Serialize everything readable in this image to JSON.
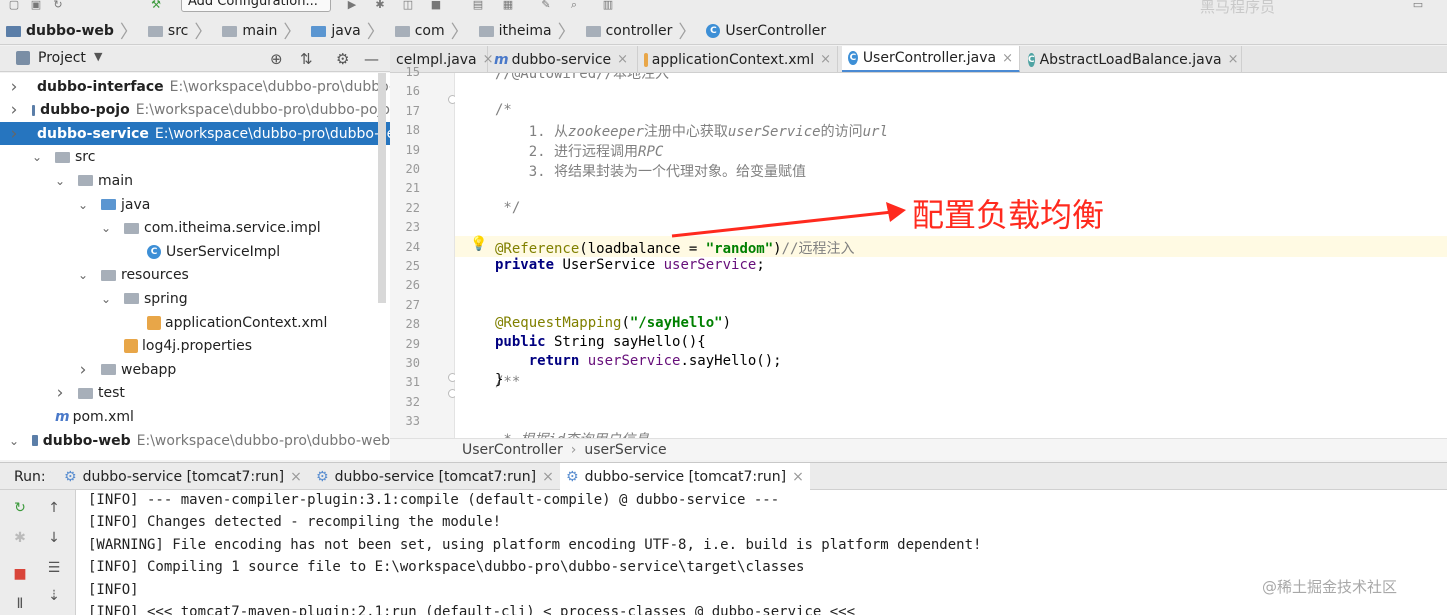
{
  "toolbar": {
    "add_configuration": "Add Configuration..."
  },
  "breadcrumbs": [
    {
      "label": "dubbo-web",
      "icon": "module-folder-icon"
    },
    {
      "label": "src",
      "icon": "folder-icon"
    },
    {
      "label": "main",
      "icon": "folder-icon"
    },
    {
      "label": "java",
      "icon": "source-folder-icon"
    },
    {
      "label": "com",
      "icon": "package-icon"
    },
    {
      "label": "itheima",
      "icon": "package-icon"
    },
    {
      "label": "controller",
      "icon": "package-icon"
    },
    {
      "label": "UserController",
      "icon": "class-icon"
    }
  ],
  "project_panel": {
    "title": "Project",
    "tree": [
      {
        "label": "dubbo-interface",
        "path": "E:\\workspace\\dubbo-pro\\dubbo-",
        "bold": true,
        "arrow": ">",
        "indent": 0,
        "icon": "module"
      },
      {
        "label": "dubbo-pojo",
        "path": "E:\\workspace\\dubbo-pro\\dubbo-pojo",
        "bold": true,
        "arrow": ">",
        "indent": 0,
        "icon": "module"
      },
      {
        "label": "dubbo-service",
        "path": "E:\\workspace\\dubbo-pro\\dubbo-service",
        "bold": true,
        "arrow": ">",
        "indent": 0,
        "icon": "module",
        "selected": true
      },
      {
        "label": "src",
        "path": "",
        "arrow": "v",
        "indent": 1,
        "icon": "folder"
      },
      {
        "label": "main",
        "path": "",
        "arrow": "v",
        "indent": 2,
        "icon": "folder"
      },
      {
        "label": "java",
        "path": "",
        "arrow": "v",
        "indent": 3,
        "icon": "source"
      },
      {
        "label": "com.itheima.service.impl",
        "path": "",
        "arrow": "v",
        "indent": 4,
        "icon": "package"
      },
      {
        "label": "UserServiceImpl",
        "path": "",
        "arrow": "",
        "indent": 5,
        "icon": "class"
      },
      {
        "label": "resources",
        "path": "",
        "arrow": "v",
        "indent": 3,
        "icon": "folder"
      },
      {
        "label": "spring",
        "path": "",
        "arrow": "v",
        "indent": 4,
        "icon": "package"
      },
      {
        "label": "applicationContext.xml",
        "path": "",
        "arrow": "",
        "indent": 5,
        "icon": "xml"
      },
      {
        "label": "log4j.properties",
        "path": "",
        "arrow": "",
        "indent": 4,
        "icon": "props"
      },
      {
        "label": "webapp",
        "path": "",
        "arrow": ">",
        "indent": 3,
        "icon": "folder"
      },
      {
        "label": "test",
        "path": "",
        "arrow": ">",
        "indent": 2,
        "icon": "folder"
      },
      {
        "label": "pom.xml",
        "path": "",
        "arrow": "",
        "indent": 1,
        "icon": "maven"
      },
      {
        "label": "dubbo-web",
        "path": "E:\\workspace\\dubbo-pro\\dubbo-web",
        "bold": true,
        "arrow": "v",
        "indent": 0,
        "icon": "module"
      }
    ]
  },
  "editor_tabs": [
    {
      "label": "ceImpl.java",
      "icon": "",
      "closable": true
    },
    {
      "label": "dubbo-service",
      "icon": "m",
      "closable": true
    },
    {
      "label": "applicationContext.xml",
      "icon": "xml",
      "closable": true
    },
    {
      "label": "UserController.java",
      "icon": "class",
      "closable": true,
      "active": true
    },
    {
      "label": "AbstractLoadBalance.java",
      "icon": "class",
      "closable": true
    }
  ],
  "code": {
    "line_numbers": [
      "15",
      "16",
      "17",
      "18",
      "19",
      "20",
      "21",
      "22",
      "23",
      "24",
      "25",
      "26",
      "27",
      "28",
      "29",
      "30",
      "31",
      "32",
      "33"
    ],
    "lines": {
      "l15": "//@Autowired//本地注入",
      "l17": "/*",
      "l18a": "    1. 从",
      "l18b": "zookeeper",
      "l18c": "注册中心获取",
      "l18d": "userService",
      "l18e": "的访问",
      "l18f": "url",
      "l19a": "    2. 进行远程调用",
      "l19b": "RPC",
      "l20": "    3. 将结果封装为一个代理对象。给变量赋值",
      "l22": " */",
      "l24a": "@Reference",
      "l24b": "(loadbalance = ",
      "l24c": "\"random\"",
      "l24d": ")",
      "l24e": "//远程注入",
      "l25a": "private",
      "l25b": " UserService ",
      "l25c": "userService",
      "l25d": ";",
      "l28a": "@RequestMapping",
      "l28b": "(",
      "l28c": "\"/sayHello\"",
      "l28d": ")",
      "l29a": "public",
      "l29b": " String sayHello(){",
      "l30a": "    return",
      "l30b": " ",
      "l30c": "userService",
      "l30d": ".sayHello();",
      "l31": "}",
      "l33": "/**",
      "l34": " * 根据id查询用户信息"
    }
  },
  "annotation": {
    "text": "配置负载均衡",
    "color": "#ff2a1e"
  },
  "status_breadcrumb": {
    "class": "UserController",
    "field": "userService"
  },
  "run_panel": {
    "label": "Run:",
    "tabs": [
      {
        "label": "dubbo-service [tomcat7:run]"
      },
      {
        "label": "dubbo-service [tomcat7:run]"
      },
      {
        "label": "dubbo-service [tomcat7:run]",
        "active": true
      }
    ],
    "console": [
      "[INFO] --- maven-compiler-plugin:3.1:compile (default-compile) @ dubbo-service ---",
      "[INFO] Changes detected - recompiling the module!",
      "[WARNING] File encoding has not been set, using platform encoding UTF-8, i.e. build is platform dependent!",
      "[INFO] Compiling 1 source file to E:\\workspace\\dubbo-pro\\dubbo-service\\target\\classes",
      "[INFO]",
      "[INFO] <<< tomcat7-maven-plugin:2.1:run (default-cli) < process-classes @ dubbo-service <<<"
    ]
  },
  "watermark": {
    "bottom": "@稀土掘金技术社区",
    "top": "黑马程序员"
  },
  "colors": {
    "selection": "#2675bf",
    "annotation": "#ff2a1e",
    "active_tab_underline": "#4a8ad3"
  }
}
